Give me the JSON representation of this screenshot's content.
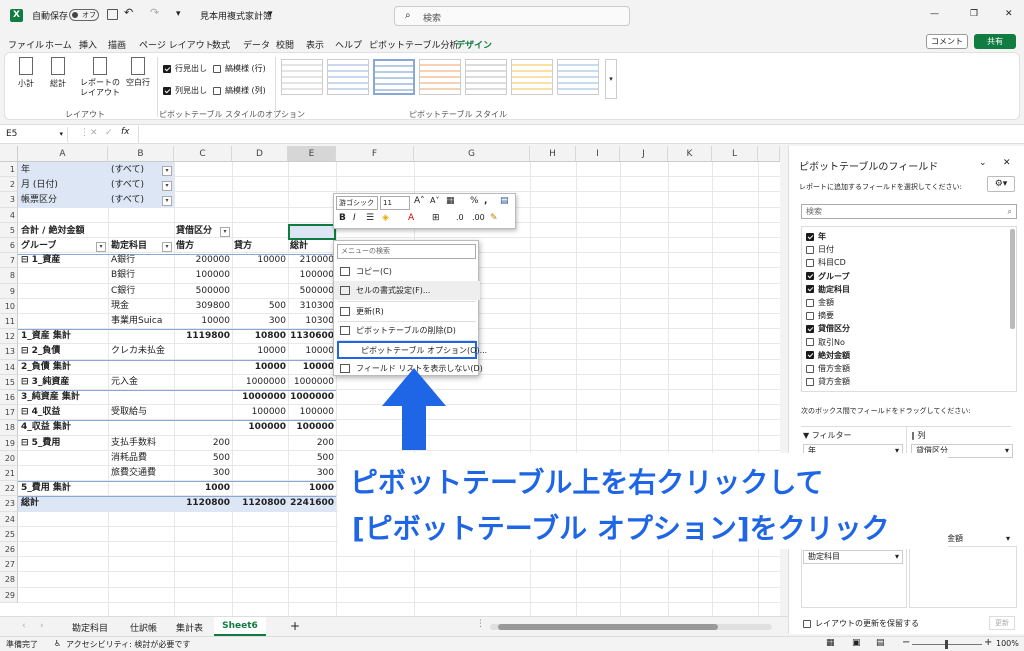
{
  "titlebar": {
    "autosave": "自動保存",
    "autosave_state": "オフ",
    "filename": "見本用複式家計簿",
    "search_placeholder": "検索"
  },
  "ribbon_tabs": [
    "ファイル",
    "ホーム",
    "挿入",
    "描画",
    "ページ レイアウト",
    "数式",
    "データ",
    "校閲",
    "表示",
    "ヘルプ",
    "ピボットテーブル分析",
    "デザイン"
  ],
  "ribbon": {
    "comment": "コメント",
    "share": "共有",
    "layout_buttons": [
      "小計",
      "総計",
      "レポートのレイアウト",
      "空白行"
    ],
    "layout_group": "レイアウト",
    "options": [
      "行見出し",
      "縞模様 (行)",
      "列見出し",
      "縞模様 (列)"
    ],
    "options_group": "ピボットテーブル スタイルのオプション",
    "styles_group": "ピボットテーブル スタイル"
  },
  "formula_bar": {
    "namebox": "E5",
    "fx": "fx"
  },
  "columns": [
    "A",
    "B",
    "C",
    "D",
    "E",
    "F",
    "G",
    "H",
    "I",
    "J",
    "K",
    "L"
  ],
  "rows": [
    "1",
    "2",
    "3",
    "4",
    "5",
    "6",
    "7",
    "8",
    "9",
    "10",
    "11",
    "12",
    "13",
    "14",
    "15",
    "16",
    "17",
    "18",
    "19",
    "20",
    "21",
    "22",
    "23",
    "24",
    "25",
    "26",
    "27",
    "28",
    "29"
  ],
  "filters": [
    {
      "label": "年",
      "value": "(すべて)"
    },
    {
      "label": "月 (日付)",
      "value": "(すべて)"
    },
    {
      "label": "帳票区分",
      "value": "(すべて)"
    }
  ],
  "pivot": {
    "corner": "合計 / 絶対金額",
    "col_field": "貸借区分",
    "h_group": "グループ",
    "h_account": "勘定科目",
    "h_debit": "借方",
    "h_credit": "貸方",
    "h_total": "総計",
    "body": [
      [
        "⊟ 1_資産",
        "A銀行",
        "200000",
        "10000",
        "210000"
      ],
      [
        "",
        "B銀行",
        "100000",
        "",
        "100000"
      ],
      [
        "",
        "C銀行",
        "500000",
        "",
        "500000"
      ],
      [
        "",
        "現金",
        "309800",
        "500",
        "310300"
      ],
      [
        "",
        "事業用Suica",
        "10000",
        "300",
        "10300"
      ],
      [
        "1_資産 集計",
        "",
        "1119800",
        "10800",
        "1130600"
      ],
      [
        "⊟ 2_負債",
        "クレカ未払金",
        "",
        "10000",
        "10000"
      ],
      [
        "2_負債 集計",
        "",
        "",
        "10000",
        "10000"
      ],
      [
        "⊟ 3_純資産",
        "元入金",
        "",
        "1000000",
        "1000000"
      ],
      [
        "3_純資産 集計",
        "",
        "",
        "1000000",
        "1000000"
      ],
      [
        "⊟ 4_収益",
        "受取給与",
        "",
        "100000",
        "100000"
      ],
      [
        "4_収益 集計",
        "",
        "",
        "100000",
        "100000"
      ],
      [
        "⊟ 5_費用",
        "支払手数料",
        "200",
        "",
        "200"
      ],
      [
        "",
        "消耗品費",
        "500",
        "",
        "500"
      ],
      [
        "",
        "旅費交通費",
        "300",
        "",
        "300"
      ],
      [
        "5_費用 集計",
        "",
        "1000",
        "",
        "1000"
      ],
      [
        "総計",
        "",
        "1120800",
        "1120800",
        "2241600"
      ]
    ]
  },
  "mini_toolbar": {
    "font": "游ゴシック",
    "size": "11"
  },
  "context_menu": {
    "search": "メニューの検索",
    "items": [
      "コピー(C)",
      "セルの書式設定(F)...",
      "更新(R)",
      "ピボットテーブルの削除(D)",
      "ピボットテーブル オプション(O)...",
      "フィールド リストを表示しない(D)"
    ]
  },
  "callout": {
    "line1": "ピボットテーブル上を右クリックして",
    "line2": "[ピボットテーブル オプション]をクリック"
  },
  "pane": {
    "title": "ピボットテーブルのフィールド",
    "subtitle": "レポートに追加するフィールドを選択してください:",
    "search": "検索",
    "fields": [
      {
        "name": "年",
        "checked": true
      },
      {
        "name": "日付",
        "checked": false
      },
      {
        "name": "科目CD",
        "checked": false
      },
      {
        "name": "グループ",
        "checked": true
      },
      {
        "name": "勘定科目",
        "checked": true
      },
      {
        "name": "金額",
        "checked": false
      },
      {
        "name": "摘要",
        "checked": false
      },
      {
        "name": "貸借区分",
        "checked": true
      },
      {
        "name": "取引No",
        "checked": false
      },
      {
        "name": "絶対金額",
        "checked": true
      },
      {
        "name": "借方金額",
        "checked": false
      },
      {
        "name": "貸方金額",
        "checked": false
      }
    ],
    "drag_hint": "次のボックス間でフィールドをドラッグしてください:",
    "filters_label": "フィルター",
    "columns_label": "列",
    "filter_item": "年",
    "column_item": "貸借区分",
    "row_item": "勘定科目",
    "value_item": "対金額",
    "defer": "レイアウトの更新を保留する",
    "update": "更新"
  },
  "sheet_tabs": [
    "勘定科目",
    "仕訳帳",
    "集計表",
    "Sheet6"
  ],
  "active_sheet": "Sheet6",
  "status": {
    "ready": "準備完了",
    "accessibility": "アクセシビリティ: 検討が必要です",
    "zoom": "100%"
  },
  "colors": {
    "accent": "#1f66e6",
    "excel_green": "#107c41",
    "pivot_header": "#dce6f5"
  }
}
